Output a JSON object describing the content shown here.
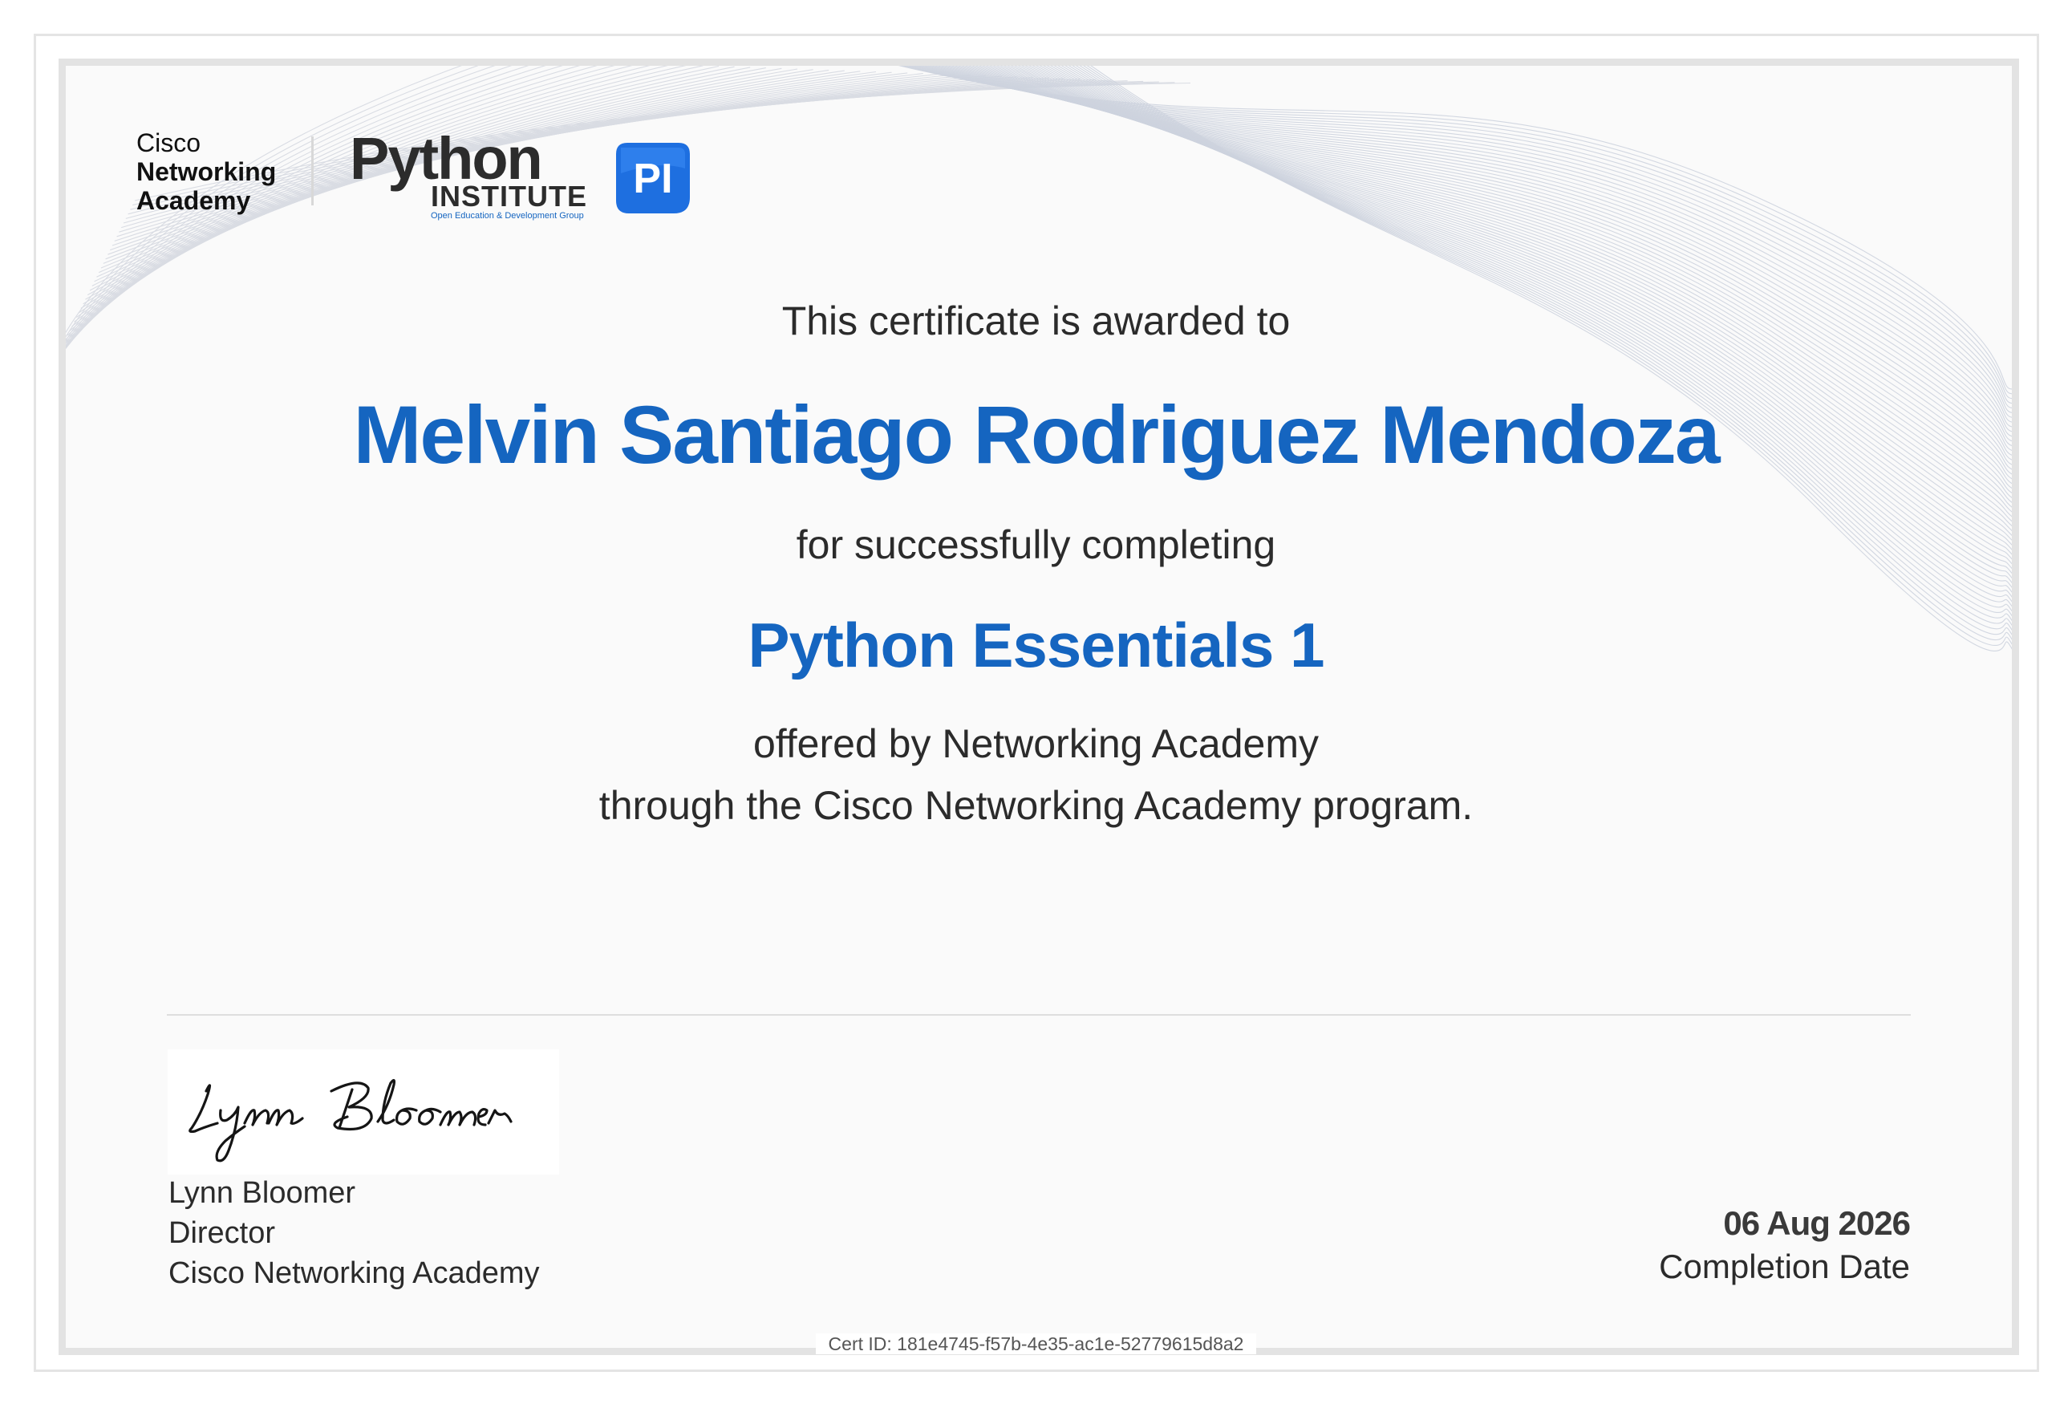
{
  "logos": {
    "cisco_line1": "Cisco",
    "cisco_line2": "Networking",
    "cisco_line3": "Academy",
    "python_word": "Python",
    "python_institute": "INSTITUTE",
    "python_tagline": "Open Education & Development Group",
    "pi_badge": "PI"
  },
  "certificate": {
    "awarded_text": "This certificate is awarded to",
    "recipient": "Melvin Santiago Rodriguez Mendoza",
    "completing_text": "for successfully completing",
    "course": "Python Essentials 1",
    "offered_text": "offered by Networking Academy",
    "program_text": "through the Cisco Networking Academy program."
  },
  "signatory": {
    "signature": "Lynn Bloomer",
    "name": "Lynn Bloomer",
    "title": "Director",
    "organization": "Cisco Networking Academy"
  },
  "completion": {
    "date": "06 Aug 2026",
    "label": "Completion Date"
  },
  "cert_id": "Cert ID: 181e4745-f57b-4e35-ac1e-52779615d8a2",
  "colors": {
    "accent": "#1565c0",
    "text": "#2b2b2b",
    "frame": "#e3e3e3",
    "background": "#fafafa"
  }
}
